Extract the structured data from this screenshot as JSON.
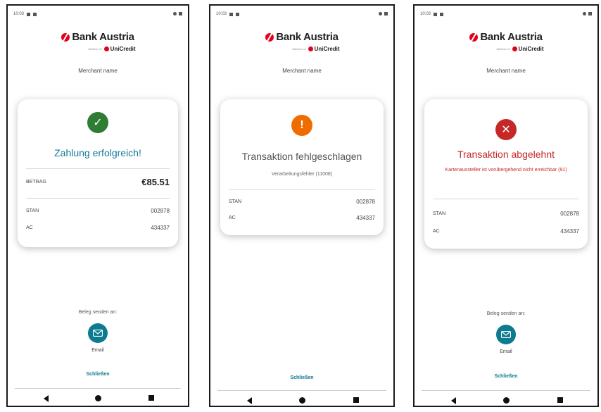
{
  "common": {
    "status_time": "10:03",
    "logo_brand": "Bank Austria",
    "logo_member": "Member of",
    "logo_unicredit": "UniCredit",
    "merchant": "Merchant name",
    "send_label": "Beleg senden an:",
    "email_label": "Email",
    "close_label": "Schließen"
  },
  "screens": [
    {
      "status": "success",
      "icon": "check-circle-icon",
      "icon_glyph": "✓",
      "icon_color": "#2e7d32",
      "title": "Zahlung erfolgreich!",
      "title_color": "#127a9a",
      "amount_label": "BETRAG",
      "amount_value": "€85.51",
      "stan_label": "STAN",
      "stan_value": "002878",
      "ac_label": "AC",
      "ac_value": "434337"
    },
    {
      "status": "failed",
      "icon": "exclamation-circle-icon",
      "icon_glyph": "!",
      "icon_color": "#ef6c00",
      "title": "Transaktion fehlgeschlagen",
      "title_color": "#555555",
      "subtitle": "Verarbeitungsfehler (11008)",
      "stan_label": "STAN",
      "stan_value": "002878",
      "ac_label": "AC",
      "ac_value": "434337"
    },
    {
      "status": "declined",
      "icon": "x-circle-icon",
      "icon_glyph": "✕",
      "icon_color": "#c62828",
      "title": "Transaktion abgelehnt",
      "title_color": "#c62828",
      "subtitle": "Kartenaussteller ist vorübergehend nicht erreichbar (91)",
      "stan_label": "STAN",
      "stan_value": "002878",
      "ac_label": "AC",
      "ac_value": "434337"
    }
  ]
}
